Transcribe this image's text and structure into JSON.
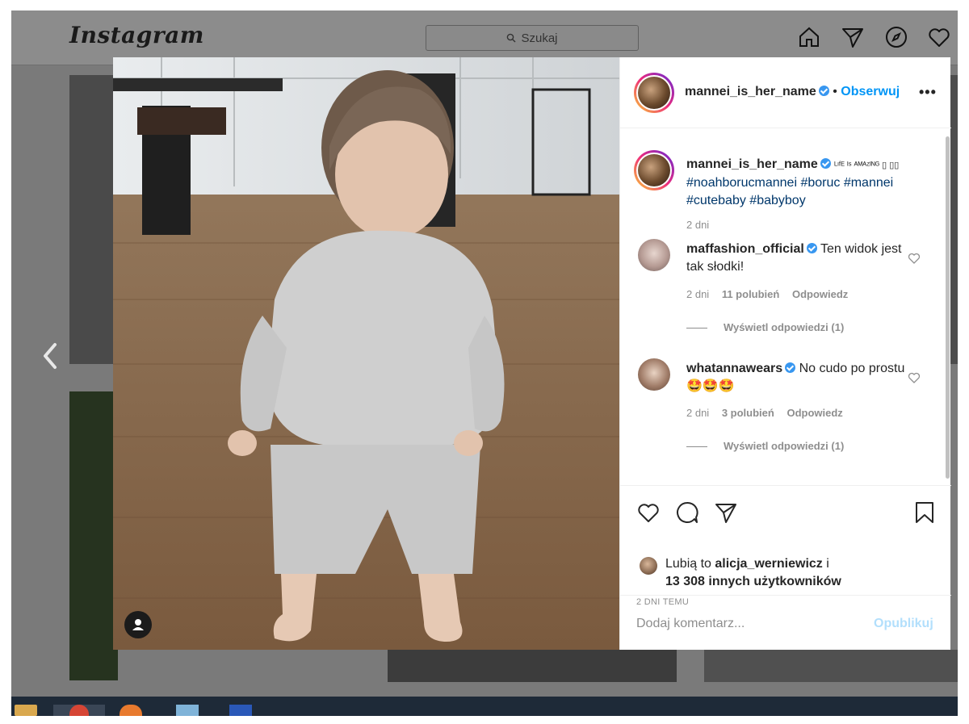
{
  "app": {
    "logo": "Instagram"
  },
  "search": {
    "placeholder": "Szukaj"
  },
  "nav": [
    "home-icon",
    "direct-icon",
    "explore-icon",
    "activity-heart-icon"
  ],
  "post": {
    "author": "mannei_is_her_name",
    "follow_label": "Obserwuj",
    "more_label": "•••",
    "separator": "•",
    "caption": {
      "user": "mannei_is_her_name",
      "text": "ᴸᶦᶠᴱ ᴵˢ ᴬᴹᴬᶻᴵᴺᴳ ▯ ▯▯",
      "hashtags": [
        "#noahborucmannei",
        "#boruc",
        "#mannei",
        "#cutebaby",
        "#babyboy"
      ],
      "time": "2 dni"
    },
    "comments": [
      {
        "user": "maffashion_official",
        "text": "Ten widok jest tak słodki!",
        "time": "2 dni",
        "likes": "11 polubień",
        "reply_label": "Odpowiedz",
        "view_replies": "Wyświetl odpowiedzi (1)"
      },
      {
        "user": "whatannawears",
        "text": "No cudo po prostu 🤩🤩🤩",
        "time": "2 dni",
        "likes": "3 polubień",
        "reply_label": "Odpowiedz",
        "view_replies": "Wyświetl odpowiedzi (1)"
      }
    ],
    "likes": {
      "prefix": "Lubią to",
      "user": "alicja_werniewicz",
      "suffix": "i",
      "count_text": "13 308 innych użytkowników"
    },
    "date": "2 DNI TEMU",
    "add_comment_placeholder": "Dodaj komentarz...",
    "publish_label": "Opublikuj"
  },
  "colors": {
    "link": "#0095f6",
    "hashtag": "#00376b",
    "publish_disabled": "#b2dffc",
    "overlay": "#7a7a7a"
  }
}
